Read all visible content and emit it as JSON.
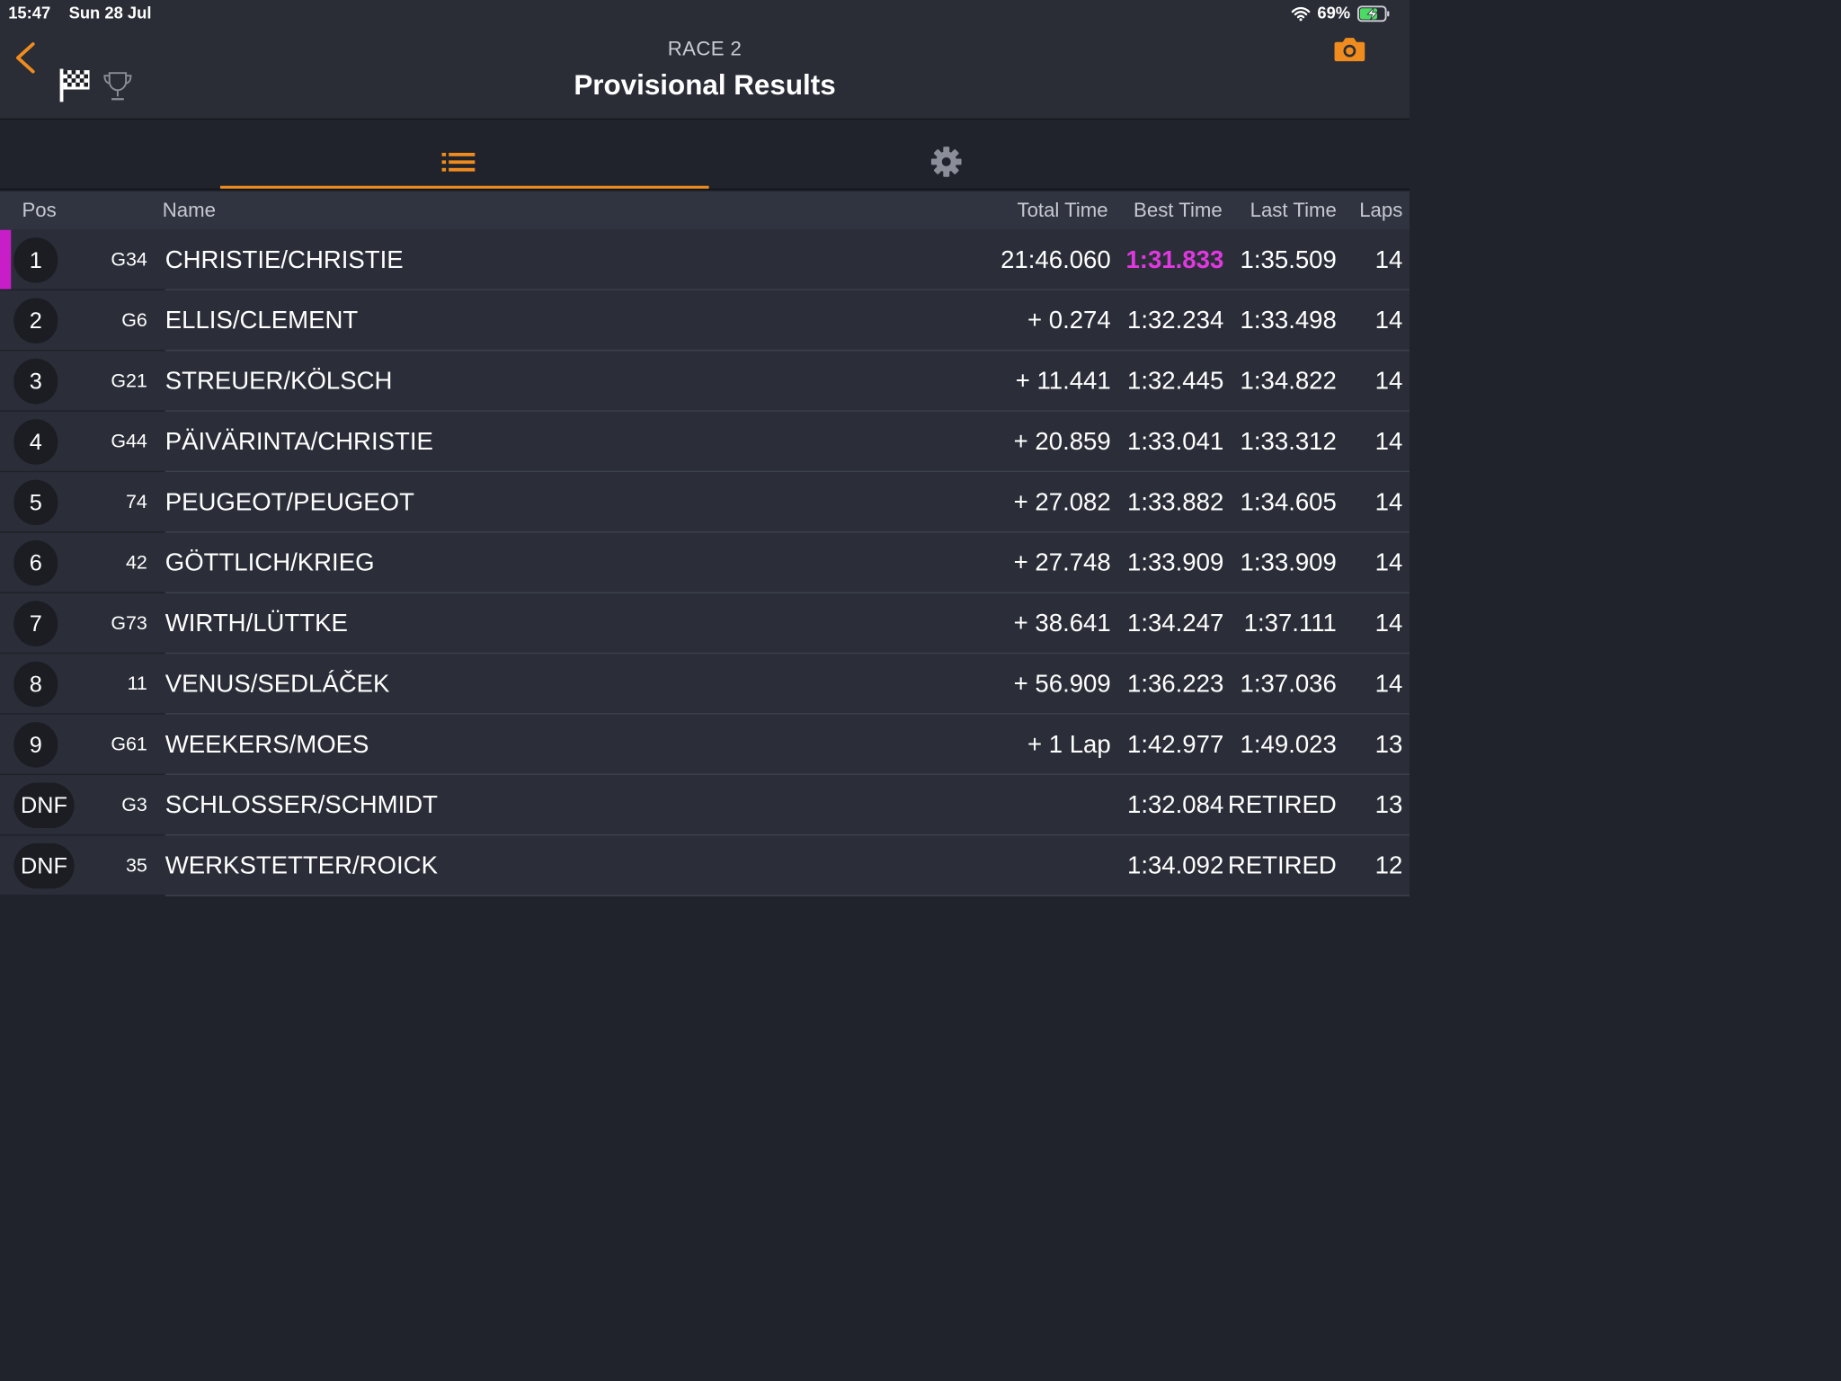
{
  "status_bar": {
    "time": "15:47",
    "date": "Sun 28 Jul",
    "battery": "69%"
  },
  "header": {
    "subtitle": "RACE 2",
    "title": "Provisional Results"
  },
  "table": {
    "columns": {
      "pos": "Pos",
      "name": "Name",
      "total_time": "Total Time",
      "best_time": "Best Time",
      "last_time": "Last Time",
      "laps": "Laps"
    },
    "rows": [
      {
        "pos": "1",
        "car": "G34",
        "name": "CHRISTIE/CHRISTIE",
        "total": "21:46.060",
        "best": "1:31.833",
        "last": "1:35.509",
        "laps": "14",
        "leader": true
      },
      {
        "pos": "2",
        "car": "G6",
        "name": "ELLIS/CLEMENT",
        "total": "+ 0.274",
        "best": "1:32.234",
        "last": "1:33.498",
        "laps": "14"
      },
      {
        "pos": "3",
        "car": "G21",
        "name": "STREUER/KÖLSCH",
        "total": "+ 11.441",
        "best": "1:32.445",
        "last": "1:34.822",
        "laps": "14"
      },
      {
        "pos": "4",
        "car": "G44",
        "name": "PÄIVÄRINTA/CHRISTIE",
        "total": "+ 20.859",
        "best": "1:33.041",
        "last": "1:33.312",
        "laps": "14"
      },
      {
        "pos": "5",
        "car": "74",
        "name": "PEUGEOT/PEUGEOT",
        "total": "+ 27.082",
        "best": "1:33.882",
        "last": "1:34.605",
        "laps": "14"
      },
      {
        "pos": "6",
        "car": "42",
        "name": "GÖTTLICH/KRIEG",
        "total": "+ 27.748",
        "best": "1:33.909",
        "last": "1:33.909",
        "laps": "14"
      },
      {
        "pos": "7",
        "car": "G73",
        "name": "WIRTH/LÜTTKE",
        "total": "+ 38.641",
        "best": "1:34.247",
        "last": "1:37.111",
        "laps": "14"
      },
      {
        "pos": "8",
        "car": "11",
        "name": "VENUS/SEDLÁČEK",
        "total": "+ 56.909",
        "best": "1:36.223",
        "last": "1:37.036",
        "laps": "14"
      },
      {
        "pos": "9",
        "car": "G61",
        "name": "WEEKERS/MOES",
        "total": "+ 1 Lap",
        "best": "1:42.977",
        "last": "1:49.023",
        "laps": "13"
      },
      {
        "pos": "DNF",
        "car": "G3",
        "name": "SCHLOSSER/SCHMIDT",
        "total": "",
        "best": "1:32.084",
        "last": "RETIRED",
        "laps": "13"
      },
      {
        "pos": "DNF",
        "car": "35",
        "name": "WERKSTETTER/ROICK",
        "total": "",
        "best": "1:34.092",
        "last": "RETIRED",
        "laps": "12"
      }
    ]
  },
  "colors": {
    "accent": "#f08c1e",
    "leader": "#c81ec8",
    "best_lap": "#e038e0",
    "background": "#20232b",
    "row": "#2b2e38"
  }
}
